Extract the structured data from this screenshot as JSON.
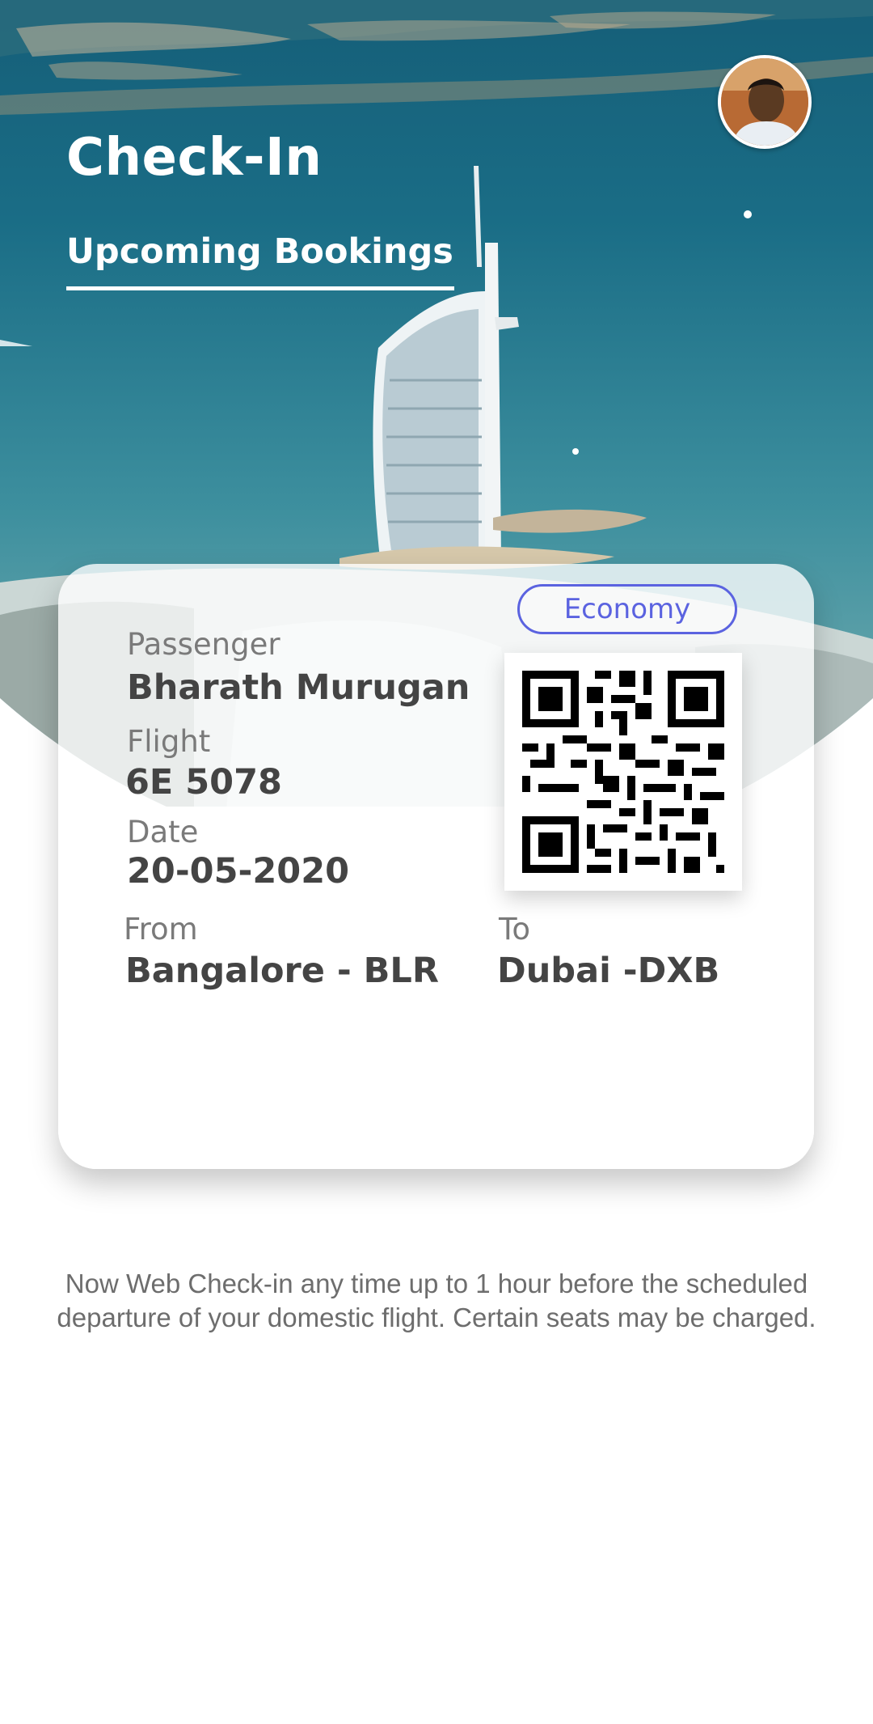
{
  "header": {
    "title": "Check-In",
    "tab_label": "Upcoming Bookings",
    "avatar_icon": "user-avatar"
  },
  "booking": {
    "class_label": "Economy",
    "passenger_label": "Passenger",
    "passenger_name": "Bharath Murugan",
    "flight_label": "Flight",
    "flight_number": "6E 5078",
    "date_label": "Date",
    "date_value": "20-05-2020",
    "from_label": "From",
    "from_value": "Bangalore - BLR",
    "to_label": "To",
    "to_value": "Dubai -DXB",
    "qr_icon": "qr-code"
  },
  "footer": {
    "notice_line1": "Now Web Check-in any time up to 1 hour before the scheduled",
    "notice_line2": "departure of your domestic flight. Certain seats may be charged."
  },
  "colors": {
    "accent": "#5b63e0",
    "text_dark": "#444444",
    "text_muted": "#7a7a7a"
  }
}
